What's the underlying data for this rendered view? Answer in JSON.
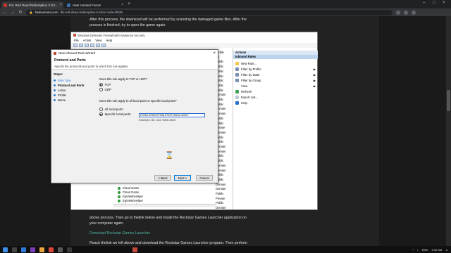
{
  "browser": {
    "tabs": [
      {
        "title": "Fix: Red Dead Redemption 2 Err...",
        "active": true
      },
      {
        "title": "Hate Usmani Forum",
        "active": false
      }
    ],
    "url_host": "hateusmani.com",
    "url_path": "/fix-red-dead-redemption-2-error-code-/0536"
  },
  "article": {
    "para1_l1": "After this process, the download will be performed by scanning the damaged game files. After the",
    "para1_l2": "process is finished, try to open the game again.",
    "para2_l1": "above process. Then go to thelink below and install the Rockstar Games Launcher application on",
    "para2_l2": "your computer again.",
    "link": "Download Rockstar Games Launcher",
    "para3_l1": "Reach thelink we left above and download the Rockstar Games Launcher program. Then perform"
  },
  "firewall": {
    "title": "Windows Defender Firewall with Advanced Security",
    "menu": [
      "File",
      "Action",
      "View",
      "Help"
    ],
    "list_items": [
      {
        "name": "Cloud Game",
        "profile": "All"
      },
      {
        "name": "Cloud Game",
        "profile": "All"
      },
      {
        "name": "EpicWebHelper",
        "profile": "Public"
      },
      {
        "name": "EpicWebHelper",
        "profile": "Private"
      },
      {
        "name": "fallguys_client_game",
        "profile": "Public"
      }
    ],
    "profile_column": [
      "Profile",
      "All",
      "Public",
      "Public",
      "Public",
      "Public",
      "Public",
      "Public",
      "Public",
      "Domain",
      "Public",
      "Public",
      "Domain",
      "Domain",
      "Public",
      "Public",
      "Private",
      "Domain",
      "Public",
      "Public",
      "Domain",
      "Domain",
      "Public",
      "Public",
      "Domain",
      "Domain",
      "Public",
      "Public",
      "Domain",
      "Domain",
      "Public",
      "Private",
      "Public",
      "Domain"
    ],
    "actions_header": "Actions",
    "actions_sub": "Inbound Rules",
    "actions": [
      {
        "label": "New Rule...",
        "arrow": false
      },
      {
        "label": "Filter by Profile",
        "arrow": true
      },
      {
        "label": "Filter by State",
        "arrow": true
      },
      {
        "label": "Filter by Group",
        "arrow": true
      },
      {
        "label": "View",
        "arrow": true
      },
      {
        "label": "Refresh",
        "arrow": false
      },
      {
        "label": "Export List...",
        "arrow": false
      },
      {
        "label": "Help",
        "arrow": false
      }
    ]
  },
  "wizard": {
    "title": "New Inbound Rule Wizard",
    "heading": "Protocol and Ports",
    "subheading": "Specify the protocols and ports to which this rule applies.",
    "steps_title": "Steps:",
    "steps": [
      "Rule Type",
      "Protocol and Ports",
      "Action",
      "Profile",
      "Name"
    ],
    "q1": "Does this rule apply to TCP or UDP?",
    "tcp": "TCP",
    "udp": "UDP",
    "q2": "Does this rule apply to all local ports or specific local ports?",
    "all_ports": "All local ports",
    "specific_ports": "Specific local ports:",
    "ports_value": "27015-27030,27036,27037,30211-30217",
    "ports_example": "Example: 80, 443, 5000-5010",
    "back": "< Back",
    "next": "Next >",
    "cancel": "Cancel"
  },
  "taskbar": {
    "lang": "ENG",
    "time": "9:42 AM"
  },
  "colors": {
    "accent": "#0078d7",
    "link": "#4fb3a0",
    "allow_rule": "#2e9b3c"
  }
}
